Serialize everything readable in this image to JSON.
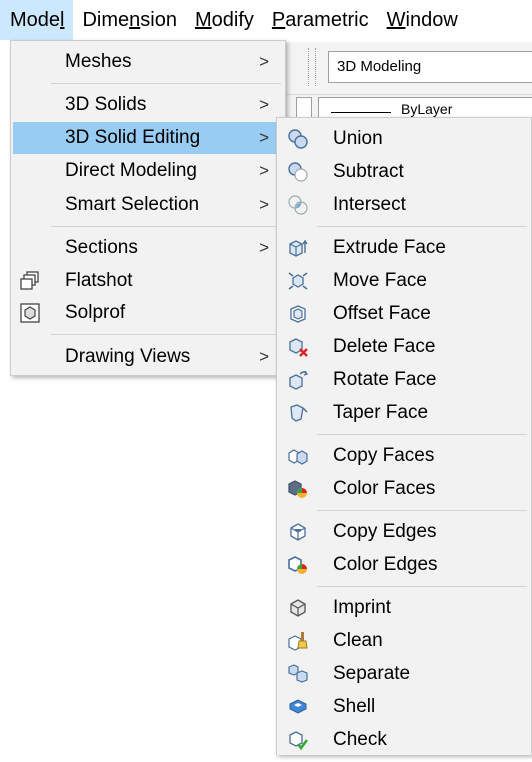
{
  "menubar": {
    "items": [
      {
        "pre": "Mode",
        "ul": "l",
        "post": ""
      },
      {
        "pre": "Dime",
        "ul": "n",
        "post": "sion"
      },
      {
        "pre": "",
        "ul": "M",
        "post": "odify"
      },
      {
        "pre": "",
        "ul": "P",
        "post": "arametric"
      },
      {
        "pre": "",
        "ul": "W",
        "post": "indow"
      }
    ]
  },
  "workspace": {
    "value": "3D Modeling",
    "layer_value": "ByLayer"
  },
  "model_menu": {
    "items": [
      {
        "label": "Meshes",
        "arrow": ">"
      },
      {
        "label": "3D Solids",
        "arrow": ">"
      },
      {
        "label": "3D Solid Editing",
        "arrow": ">"
      },
      {
        "label": "Direct Modeling",
        "arrow": ">"
      },
      {
        "label": "Smart Selection",
        "arrow": ">"
      },
      {
        "label": "Sections",
        "arrow": ">"
      },
      {
        "label": "Flatshot",
        "icon": "flatshot-icon"
      },
      {
        "label": "Solprof",
        "icon": "solprof-icon"
      },
      {
        "label": "Drawing Views",
        "arrow": ">"
      }
    ]
  },
  "solid_editing_menu": {
    "items": [
      {
        "label": "Union",
        "icon": "union-icon"
      },
      {
        "label": "Subtract",
        "icon": "subtract-icon"
      },
      {
        "label": "Intersect",
        "icon": "intersect-icon"
      },
      {
        "label": "Extrude Face",
        "icon": "extrude-face-icon"
      },
      {
        "label": "Move Face",
        "icon": "move-face-icon"
      },
      {
        "label": "Offset Face",
        "icon": "offset-face-icon"
      },
      {
        "label": "Delete Face",
        "icon": "delete-face-icon"
      },
      {
        "label": "Rotate Face",
        "icon": "rotate-face-icon"
      },
      {
        "label": "Taper Face",
        "icon": "taper-face-icon"
      },
      {
        "label": "Copy Faces",
        "icon": "copy-faces-icon"
      },
      {
        "label": "Color Faces",
        "icon": "color-faces-icon"
      },
      {
        "label": "Copy Edges",
        "icon": "copy-edges-icon"
      },
      {
        "label": "Color Edges",
        "icon": "color-edges-icon"
      },
      {
        "label": "Imprint",
        "icon": "imprint-icon"
      },
      {
        "label": "Clean",
        "icon": "clean-icon"
      },
      {
        "label": "Separate",
        "icon": "separate-icon"
      },
      {
        "label": "Shell",
        "icon": "shell-icon"
      },
      {
        "label": "Check",
        "icon": "check-icon"
      }
    ]
  },
  "colors": {
    "active_menubar": "#cce8ff",
    "highlight": "#99ccf3",
    "menu_bg": "#f2f2f2",
    "icon_blue": "#4a6f9c",
    "delete_red": "#e0231e",
    "check_green": "#3aa53a"
  }
}
